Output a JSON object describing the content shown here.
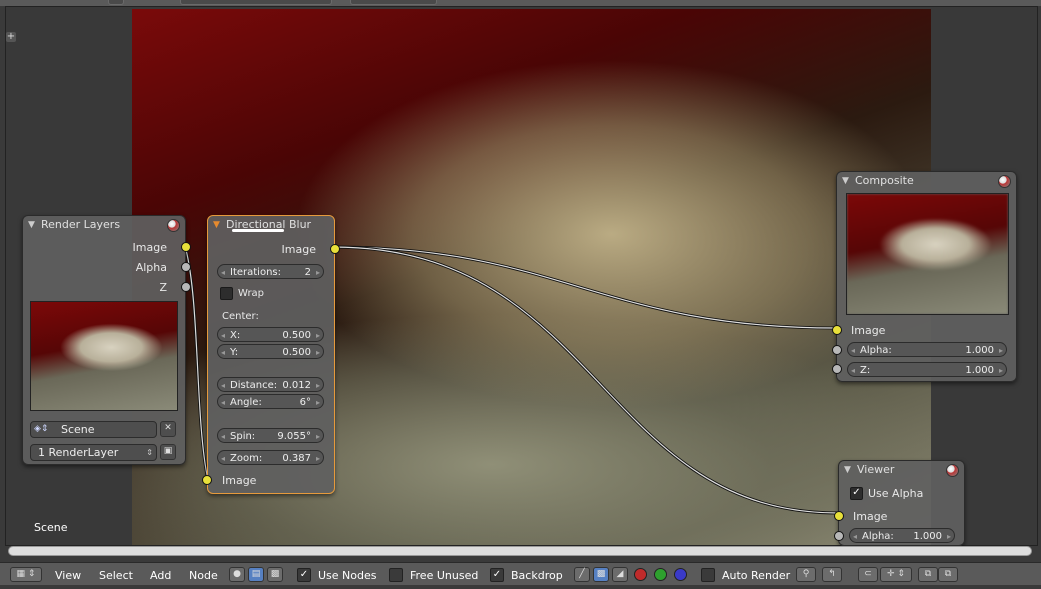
{
  "footer": {
    "menus": [
      "View",
      "Select",
      "Add",
      "Node"
    ],
    "use_nodes": {
      "label": "Use Nodes",
      "checked": true
    },
    "free_unused": {
      "label": "Free Unused",
      "checked": false
    },
    "backdrop": {
      "label": "Backdrop",
      "checked": true
    },
    "auto_render": {
      "label": "Auto Render",
      "checked": false
    }
  },
  "editor": {
    "scene_label": "Scene"
  },
  "nodes": {
    "render_layers": {
      "title": "Render Layers",
      "outputs": [
        "Image",
        "Alpha",
        "Z"
      ],
      "scene_value": "Scene",
      "layer_value": "1 RenderLayer"
    },
    "directional_blur": {
      "title": "Directional Blur",
      "output": "Image",
      "iterations": {
        "label": "Iterations:",
        "value": "2"
      },
      "wrap": {
        "label": "Wrap",
        "checked": false
      },
      "center_label": "Center:",
      "x": {
        "label": "X:",
        "value": "0.500"
      },
      "y": {
        "label": "Y:",
        "value": "0.500"
      },
      "distance": {
        "label": "Distance:",
        "value": "0.012"
      },
      "angle": {
        "label": "Angle:",
        "value": "6°"
      },
      "spin": {
        "label": "Spin:",
        "value": "9.055°"
      },
      "zoom": {
        "label": "Zoom:",
        "value": "0.387"
      },
      "input": "Image"
    },
    "composite": {
      "title": "Composite",
      "input": "Image",
      "alpha": {
        "label": "Alpha:",
        "value": "1.000"
      },
      "z": {
        "label": "Z:",
        "value": "1.000"
      }
    },
    "viewer": {
      "title": "Viewer",
      "use_alpha": {
        "label": "Use Alpha",
        "checked": true
      },
      "input": "Image",
      "alpha": {
        "label": "Alpha:",
        "value": "1.000"
      }
    }
  },
  "colors": {
    "image_socket": "#e8e03a",
    "value_socket": "#b8b8b8",
    "active_node_border": "#e69a3c"
  }
}
